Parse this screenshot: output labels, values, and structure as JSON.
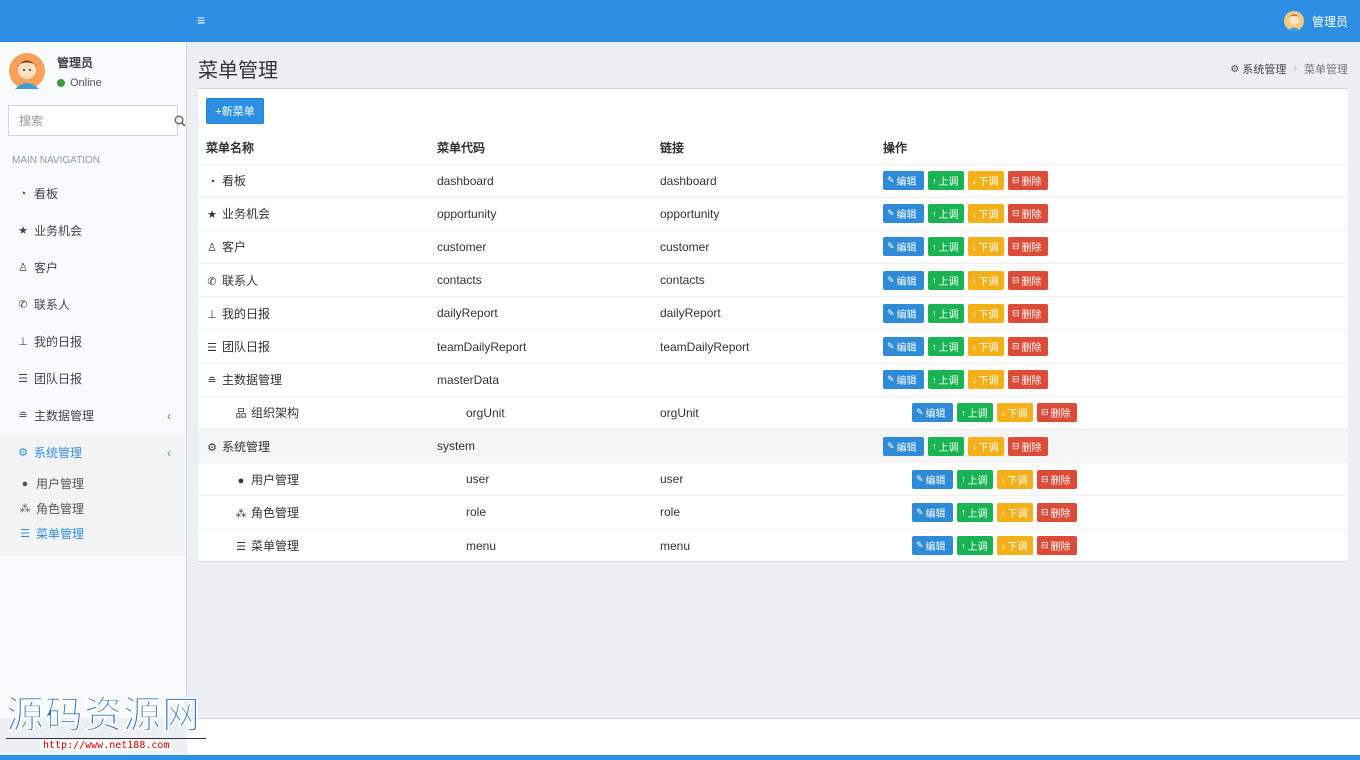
{
  "header": {
    "menu_icon": "bars-icon",
    "user_name": "管理员"
  },
  "sidebar": {
    "user": {
      "name": "管理员",
      "status": "Online"
    },
    "search": {
      "placeholder": "搜索"
    },
    "nav_header": "MAIN NAVIGATION",
    "items": [
      {
        "icon": "dashboard-icon",
        "label": "看板"
      },
      {
        "icon": "star-icon",
        "label": "业务机会"
      },
      {
        "icon": "user-tie-icon",
        "label": "客户"
      },
      {
        "icon": "phone-icon",
        "label": "联系人"
      },
      {
        "icon": "pin-icon",
        "label": "我的日报"
      },
      {
        "icon": "list-icon",
        "label": "团队日报"
      },
      {
        "icon": "database-icon",
        "label": "主数据管理"
      },
      {
        "icon": "cogs-icon",
        "label": "系统管理"
      }
    ],
    "submenu": [
      {
        "icon": "user-icon",
        "label": "用户管理"
      },
      {
        "icon": "users-icon",
        "label": "角色管理"
      },
      {
        "icon": "list-icon",
        "label": "菜单管理"
      }
    ]
  },
  "content": {
    "title": "菜单管理",
    "breadcrumb": [
      "系统管理",
      "菜单管理"
    ],
    "new_button": "+新菜单",
    "columns": [
      "菜单名称",
      "菜单代码",
      "链接",
      "操作"
    ],
    "buttons": {
      "edit": "编辑",
      "up": "上调",
      "down": "下调",
      "delete": "删除"
    },
    "rows": [
      {
        "icon": "dashboard-icon",
        "name": "看板",
        "code": "dashboard",
        "link": "dashboard",
        "level": 0
      },
      {
        "icon": "star-icon",
        "name": "业务机会",
        "code": "opportunity",
        "link": "opportunity",
        "level": 0
      },
      {
        "icon": "user-tie-icon",
        "name": "客户",
        "code": "customer",
        "link": "customer",
        "level": 0
      },
      {
        "icon": "phone-icon",
        "name": "联系人",
        "code": "contacts",
        "link": "contacts",
        "level": 0
      },
      {
        "icon": "pin-icon",
        "name": "我的日报",
        "code": "dailyReport",
        "link": "dailyReport",
        "level": 0
      },
      {
        "icon": "list-icon",
        "name": "团队日报",
        "code": "teamDailyReport",
        "link": "teamDailyReport",
        "level": 0
      },
      {
        "icon": "database-icon",
        "name": "主数据管理",
        "code": "masterData",
        "link": "",
        "level": 0
      },
      {
        "icon": "sitemap-icon",
        "name": "组织架构",
        "code": "orgUnit",
        "link": "orgUnit",
        "level": 1
      },
      {
        "icon": "cogs-icon",
        "name": "系统管理",
        "code": "system",
        "link": "",
        "level": 0
      },
      {
        "icon": "user-icon",
        "name": "用户管理",
        "code": "user",
        "link": "user",
        "level": 1
      },
      {
        "icon": "users-icon",
        "name": "角色管理",
        "code": "role",
        "link": "role",
        "level": 1
      },
      {
        "icon": "list-icon",
        "name": "菜单管理",
        "code": "menu",
        "link": "menu",
        "level": 1
      }
    ]
  },
  "watermark": {
    "title": "源码资源网",
    "url": "http://www.net188.com"
  },
  "colors": {
    "primary": "#2d8fe3",
    "edit": "#2f8bd8",
    "up": "#1ab354",
    "down": "#f5b019",
    "delete": "#dd4b39"
  }
}
